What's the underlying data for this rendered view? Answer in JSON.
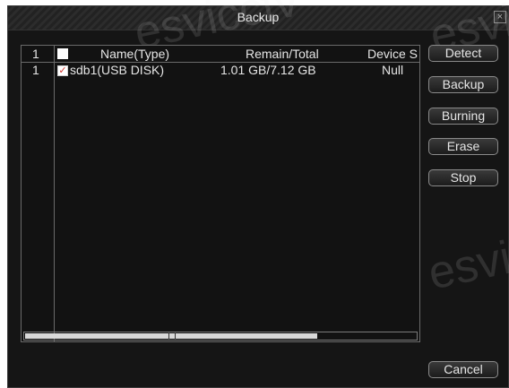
{
  "window": {
    "title": "Backup",
    "close_label": "×"
  },
  "list": {
    "columns": [
      "1",
      "Name(Type)",
      "Remain/Total",
      "Device S"
    ],
    "rows": [
      {
        "index": "1",
        "checked": true,
        "name": "sdb1(USB DISK)",
        "remain_total": "1.01 GB/7.12 GB",
        "device_status": "Null"
      }
    ]
  },
  "buttons": {
    "detect": "Detect",
    "backup": "Backup",
    "burning": "Burning",
    "erase": "Erase",
    "stop": "Stop",
    "cancel": "Cancel"
  },
  "watermark": "esvicctv",
  "colors": {
    "background": "#151515",
    "text": "#e6e6e6",
    "border": "#6a6a6a",
    "check": "#d0342c"
  }
}
